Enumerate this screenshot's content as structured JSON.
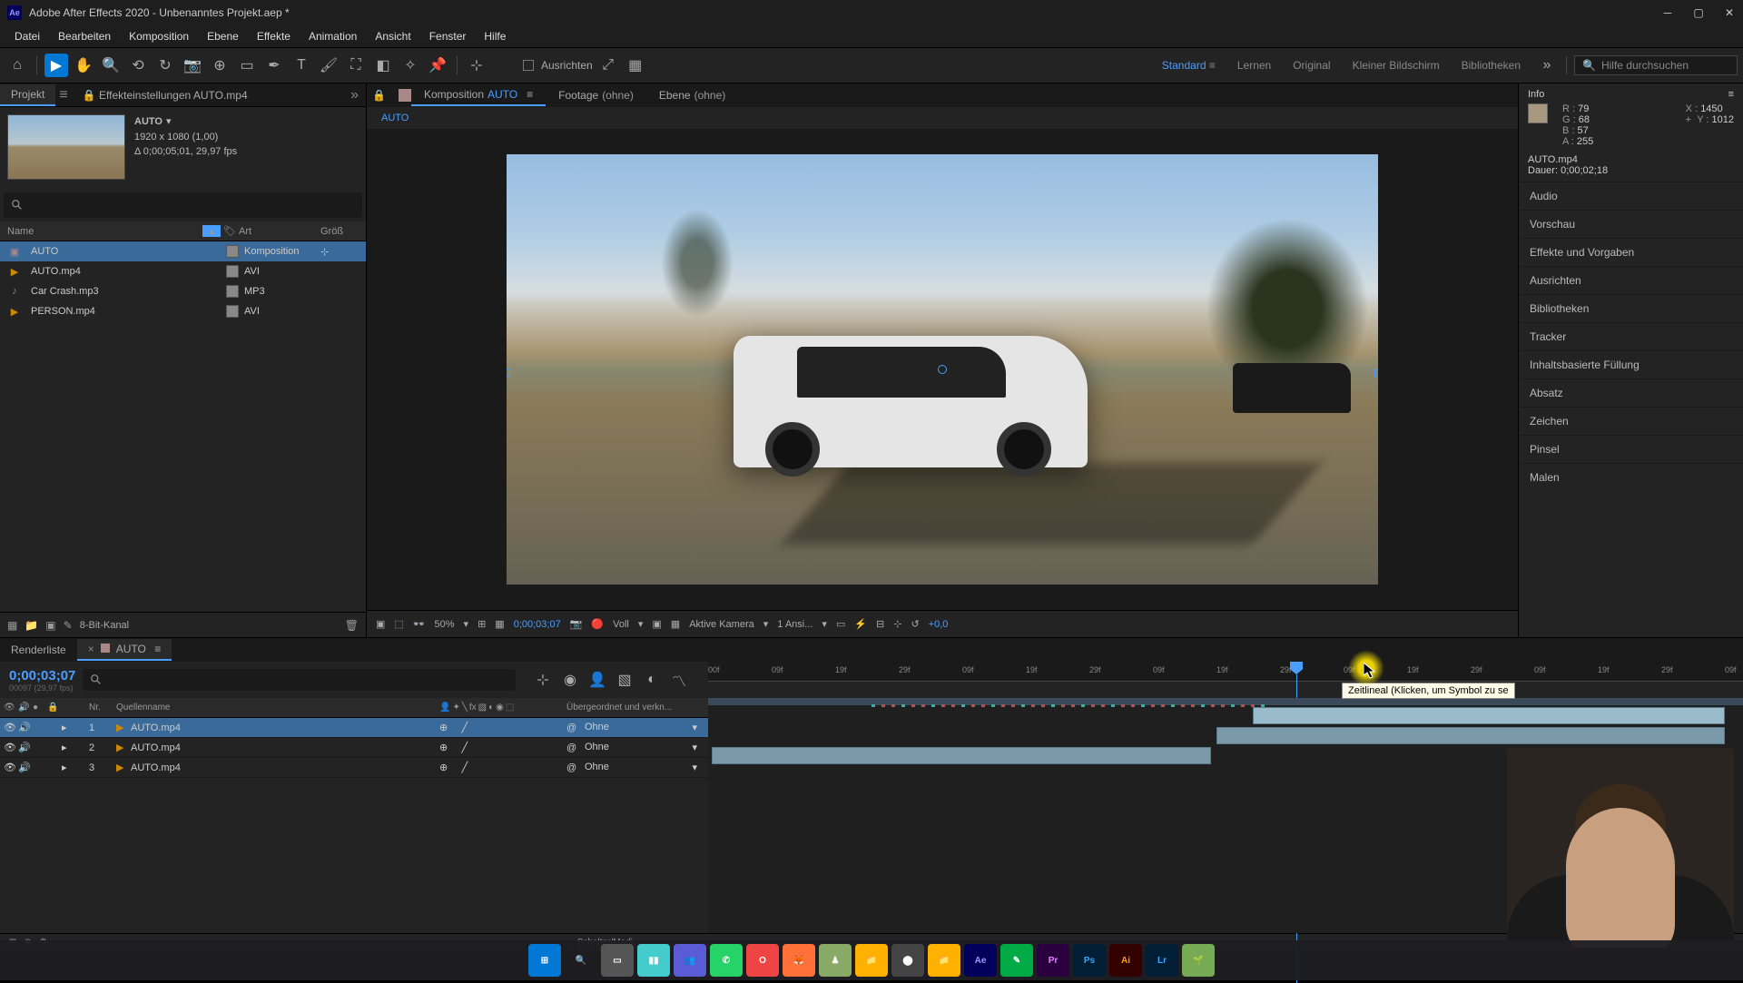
{
  "titlebar": {
    "app": "Ae",
    "title": "Adobe After Effects 2020 - Unbenanntes Projekt.aep *"
  },
  "menu": [
    "Datei",
    "Bearbeiten",
    "Komposition",
    "Ebene",
    "Effekte",
    "Animation",
    "Ansicht",
    "Fenster",
    "Hilfe"
  ],
  "toolbar": {
    "align_label": "Ausrichten",
    "workspaces": [
      "Standard",
      "Lernen",
      "Original",
      "Kleiner Bildschirm",
      "Bibliotheken"
    ],
    "active_workspace": "Standard",
    "search_placeholder": "Hilfe durchsuchen"
  },
  "project_panel": {
    "tab_project": "Projekt",
    "tab_effect": "Effekteinstellungen AUTO.mp4",
    "selected_name": "AUTO",
    "resolution": "1920 x 1080 (1,00)",
    "duration": "Δ 0;00;05;01, 29,97 fps",
    "columns": {
      "name": "Name",
      "type": "Art",
      "size": "Größ"
    },
    "items": [
      {
        "name": "AUTO",
        "type": "Komposition",
        "icon": "comp",
        "selected": true
      },
      {
        "name": "AUTO.mp4",
        "type": "AVI",
        "icon": "video"
      },
      {
        "name": "Car Crash.mp3",
        "type": "MP3",
        "icon": "audio"
      },
      {
        "name": "PERSON.mp4",
        "type": "AVI",
        "icon": "video"
      }
    ],
    "footer_label": "8-Bit-Kanal"
  },
  "comp_panel": {
    "tab_comp_prefix": "Komposition",
    "tab_comp_name": "AUTO",
    "tab_footage": "Footage",
    "tab_footage_none": "(ohne)",
    "tab_layer": "Ebene",
    "tab_layer_none": "(ohne)",
    "breadcrumb": "AUTO"
  },
  "viewer_footer": {
    "zoom": "50%",
    "timecode": "0;00;03;07",
    "resolution": "Voll",
    "camera": "Aktive Kamera",
    "views": "1 Ansi...",
    "exposure": "+0,0"
  },
  "info_panel": {
    "title": "Info",
    "R": "79",
    "G": "68",
    "B": "57",
    "A": "255",
    "X": "1450",
    "Y": "1012",
    "clip_name": "AUTO.mp4",
    "clip_dur_label": "Dauer:",
    "clip_dur": "0;00;02;18"
  },
  "right_panels": [
    "Audio",
    "Vorschau",
    "Effekte und Vorgaben",
    "Ausrichten",
    "Bibliotheken",
    "Tracker",
    "Inhaltsbasierte Füllung",
    "Absatz",
    "Zeichen",
    "Pinsel",
    "Malen"
  ],
  "timeline": {
    "tab_render": "Renderliste",
    "tab_comp": "AUTO",
    "timecode": "0;00;03;07",
    "subtime": "00097 (29,97 fps)",
    "header": {
      "nr": "Nr.",
      "source": "Quellenname",
      "parent": "Übergeordnet und verkn..."
    },
    "parent_value": "Ohne",
    "layers": [
      {
        "nr": "1",
        "name": "AUTO.mp4",
        "selected": true
      },
      {
        "nr": "2",
        "name": "AUTO.mp4",
        "selected": false
      },
      {
        "nr": "3",
        "name": "AUTO.mp4",
        "selected": false
      }
    ],
    "ruler_ticks": [
      "00f",
      "09f",
      "19f",
      "29f",
      "09f",
      "19f",
      "29f",
      "09f",
      "19f",
      "29f",
      "09f",
      "19f",
      "29f",
      "09f",
      "19f",
      "29f",
      "09f"
    ],
    "footer_label": "Schalter/Modi",
    "tooltip": "Zeitlineal (Klicken, um Symbol zu se"
  },
  "taskbar": {
    "icons": [
      {
        "bg": "#0078d4",
        "fg": "#fff",
        "txt": "⊞"
      },
      {
        "bg": "transparent",
        "fg": "#fff",
        "txt": "🔍"
      },
      {
        "bg": "#555",
        "fg": "#fff",
        "txt": "▭"
      },
      {
        "bg": "#4cc",
        "fg": "#fff",
        "txt": "▮▮"
      },
      {
        "bg": "#5b5bd6",
        "fg": "#fff",
        "txt": "👥"
      },
      {
        "bg": "#25d366",
        "fg": "#fff",
        "txt": "✆"
      },
      {
        "bg": "#e44",
        "fg": "#fff",
        "txt": "O"
      },
      {
        "bg": "#ff7139",
        "fg": "#fff",
        "txt": "🦊"
      },
      {
        "bg": "#8a6",
        "fg": "#fff",
        "txt": "♟"
      },
      {
        "bg": "#ffb000",
        "fg": "#000",
        "txt": "📁"
      },
      {
        "bg": "#444",
        "fg": "#fff",
        "txt": "⬤"
      },
      {
        "bg": "#ffb000",
        "fg": "#000",
        "txt": "📁"
      },
      {
        "bg": "#00005b",
        "fg": "#9999ff",
        "txt": "Ae"
      },
      {
        "bg": "#0a4",
        "fg": "#fff",
        "txt": "✎"
      },
      {
        "bg": "#2a003f",
        "fg": "#e085ff",
        "txt": "Pr"
      },
      {
        "bg": "#001e36",
        "fg": "#31a8ff",
        "txt": "Ps"
      },
      {
        "bg": "#330000",
        "fg": "#ff9a00",
        "txt": "Ai"
      },
      {
        "bg": "#001e36",
        "fg": "#31a8ff",
        "txt": "Lr"
      },
      {
        "bg": "#7a5",
        "fg": "#fff",
        "txt": "🌱"
      }
    ]
  }
}
